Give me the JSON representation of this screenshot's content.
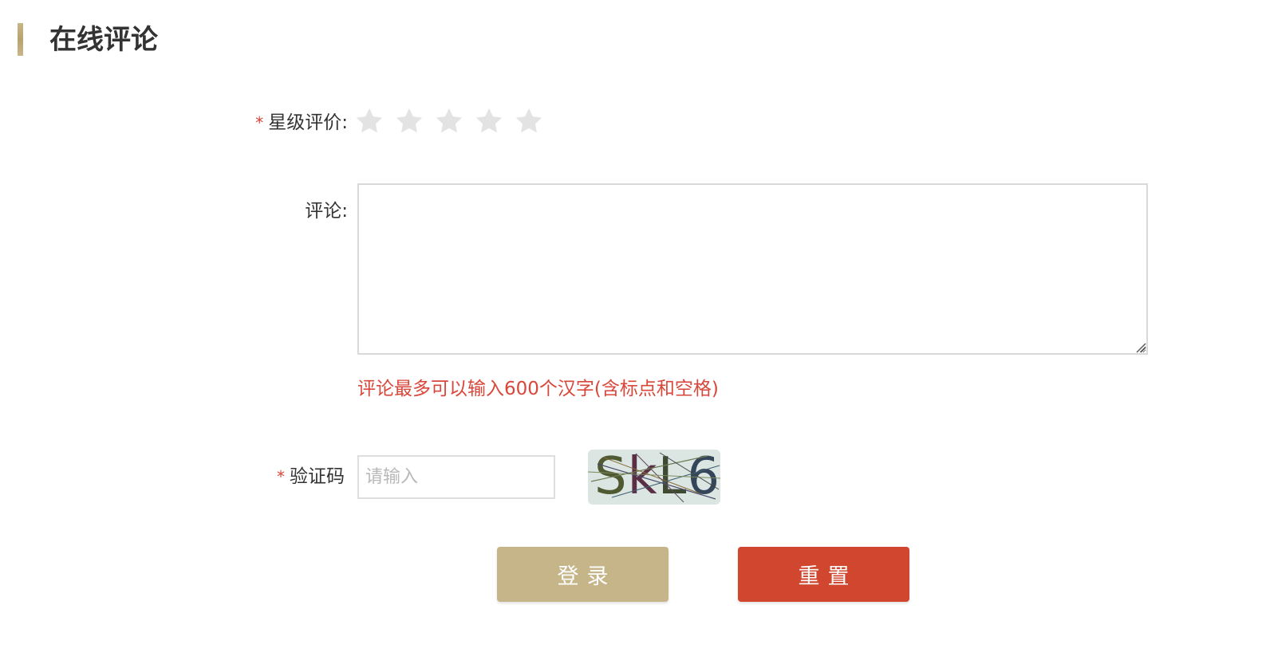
{
  "header": {
    "title": "在线评论"
  },
  "form": {
    "rating": {
      "required_mark": "*",
      "label": "星级评价:",
      "value": 0,
      "max": 5,
      "star_color": "#e3e3e3"
    },
    "comment": {
      "label": "评论:",
      "value": "",
      "hint": "评论最多可以输入600个汉字(含标点和空格)"
    },
    "captcha": {
      "required_mark": "*",
      "label": "验证码",
      "placeholder": "请输入",
      "value": "",
      "image_text": "SkL6"
    }
  },
  "buttons": {
    "login_label": "登录",
    "reset_label": "重置"
  },
  "colors": {
    "accent": "#c5b589",
    "danger": "#d0462f",
    "hint": "#d9463a"
  }
}
